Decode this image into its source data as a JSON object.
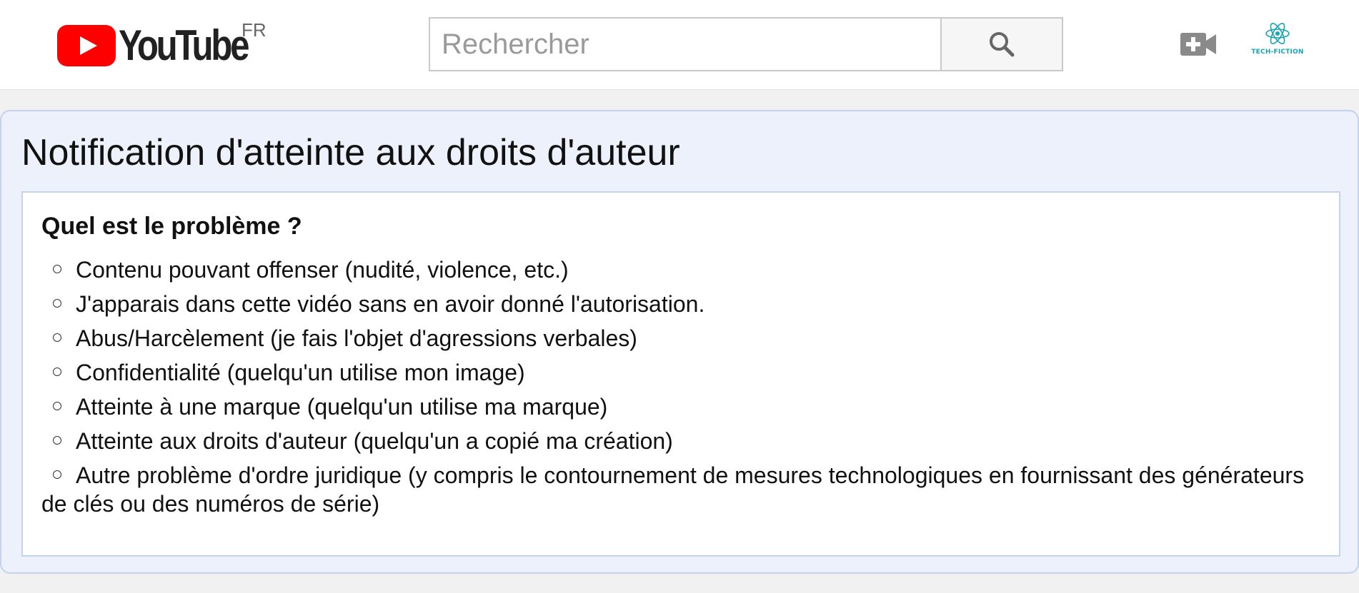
{
  "header": {
    "logo_text": "YouTube",
    "region": "FR",
    "search": {
      "placeholder": "Rechercher",
      "value": ""
    },
    "channel_avatar_label": "TECH-FICTION",
    "colors": {
      "logo_red": "#ff0000",
      "avatar_teal": "#17a3b2"
    }
  },
  "main": {
    "title": "Notification d'atteinte aux droits d'auteur",
    "question": "Quel est le problème ?",
    "options": [
      "Contenu pouvant offenser (nudité, violence, etc.)",
      "J'apparais dans cette vidéo sans en avoir donné l'autorisation.",
      "Abus/Harcèlement (je fais l'objet d'agressions verbales)",
      "Confidentialité (quelqu'un utilise mon image)",
      "Atteinte à une marque (quelqu'un utilise ma marque)",
      "Atteinte aux droits d'auteur (quelqu'un a copié ma création)",
      "Autre problème d'ordre juridique (y compris le contournement de mesures technologiques en fournissant des générateurs de clés ou des numéros de série)"
    ]
  },
  "icons": {
    "search": "search-icon",
    "upload": "video-camera-plus-icon",
    "logo": "youtube-play-icon"
  }
}
